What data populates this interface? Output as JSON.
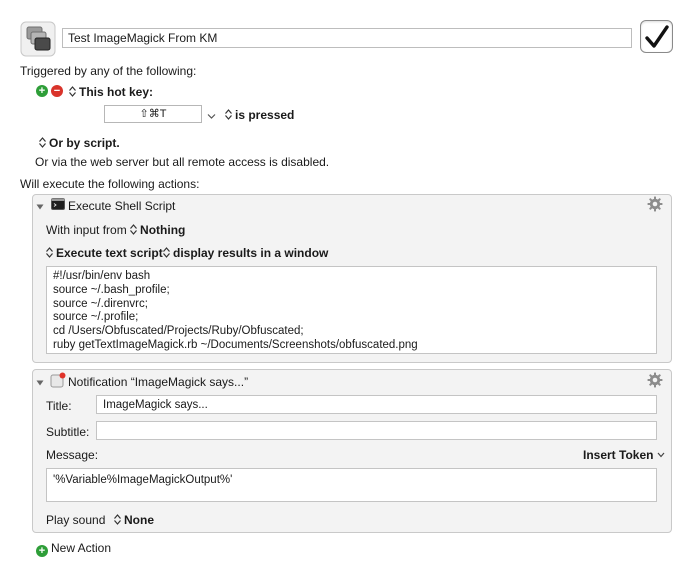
{
  "macro": {
    "name": "Test ImageMagick From KM",
    "enabled": true
  },
  "triggers": {
    "header": "Triggered by any of the following:",
    "hotkey_label": "This hot key:",
    "hotkey_value": "⇧⌘T",
    "hotkey_condition": "is pressed",
    "script_label": "Or by script.",
    "web_server_note": "Or via the web server but all remote access is disabled."
  },
  "actions_header": "Will execute the following actions:",
  "actions": {
    "shell": {
      "title": "Execute Shell Script",
      "input_label": "With input from",
      "input_value": "Nothing",
      "mode": "Execute text script",
      "output": "display results in a window",
      "script_lines": [
        "#!/usr/bin/env bash",
        "source ~/.bash_profile;",
        "source ~/.direnvrc;",
        "source ~/.profile;",
        "cd /Users/Obfuscated/Projects/Ruby/Obfuscated;",
        "ruby getTextImageMagick.rb ~/Documents/Screenshots/obfuscated.png"
      ]
    },
    "notification": {
      "title": "Notification “ImageMagick says...”",
      "title_label": "Title:",
      "title_value": "ImageMagick says...",
      "subtitle_label": "Subtitle:",
      "subtitle_value": "",
      "message_label": "Message:",
      "insert_token": "Insert Token",
      "message_value": "'%Variable%ImageMagickOutput%'",
      "sound_label": "Play sound",
      "sound_value": "None"
    }
  },
  "new_action": "New Action",
  "colors": {
    "add_green": "#2e9e38",
    "remove_red": "#d9342b",
    "panel_bg": "#f3f3f3"
  },
  "icons": {
    "macro": "macro-group-icon",
    "enable": "checkmark-icon",
    "settings": "gear-icon",
    "shell": "terminal-icon",
    "notification": "notification-icon"
  }
}
